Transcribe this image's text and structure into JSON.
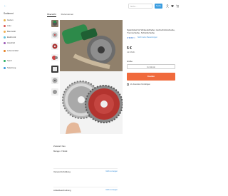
{
  "app": {
    "logo": "←"
  },
  "sidebar": {
    "title": "Sortiment",
    "items": [
      {
        "label": "Garten",
        "color": "#e8b04a"
      },
      {
        "label": "Auto",
        "color": "#d9534f"
      },
      {
        "label": "Baumarkt",
        "color": "#f0ad4e"
      },
      {
        "label": "Elektronik",
        "color": "#5bc0de"
      },
      {
        "label": "Haushalt",
        "color": "#9b59b6"
      },
      {
        "label": "Lebensmittel",
        "color": "#e67e22"
      },
      {
        "label": "Sport",
        "color": "#27ae60"
      },
      {
        "label": "Spielzeug",
        "color": "#3498db"
      }
    ]
  },
  "header": {
    "search_placeholder": "Suche…",
    "search_button": "Suche"
  },
  "tabs": [
    {
      "label": "Übersicht",
      "active": true
    },
    {
      "label": "Rezensionen",
      "active": false
    }
  ],
  "product": {
    "title": "Spänhobel für Winkelschleifer, Holzschnitzscheibe, Trennscheibe, Schleifscheibe",
    "rating_stars": "★★★★☆",
    "rating_link": "Noch keine Bewertungen",
    "price": "5 €",
    "price_sub": "inkl. MwSt.",
    "size_label": "Größe",
    "size_value": "4 x 11 mm",
    "buy_button": "Kaufen",
    "favorite_label": "Zu Favoriten hinzufügen"
  },
  "details": {
    "rows": [
      "Zustand: Neu",
      "Menge: 2 Stück"
    ]
  },
  "sections": [
    {
      "title": "Versand & Zahlung",
      "action": "Mehr anzeigen"
    },
    {
      "title": "Artikelbeschreibung",
      "action": "Mehr anzeigen"
    }
  ],
  "colors": {
    "accent": "#3b9de0",
    "buy": "#f06a3c",
    "link": "#3b8fd8"
  }
}
